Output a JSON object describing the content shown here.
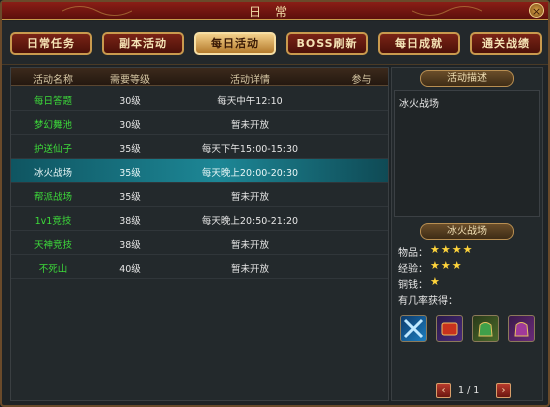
{
  "window": {
    "title": "日常",
    "close_label": "×"
  },
  "tabs": [
    {
      "label": "日常任务",
      "active": false
    },
    {
      "label": "副本活动",
      "active": false
    },
    {
      "label": "每日活动",
      "active": true
    },
    {
      "label": "BOSS刷新",
      "active": false
    },
    {
      "label": "每日成就",
      "active": false
    },
    {
      "label": "通关战绩",
      "active": false
    }
  ],
  "table": {
    "headers": [
      "活动名称",
      "需要等级",
      "活动详情",
      "参与"
    ],
    "rows": [
      {
        "name": "每日答题",
        "level": "30级",
        "detail": "每天中午12:10"
      },
      {
        "name": "梦幻舞池",
        "level": "30级",
        "detail": "暂未开放"
      },
      {
        "name": "护送仙子",
        "level": "35级",
        "detail": "每天下午15:00-15:30"
      },
      {
        "name": "冰火战场",
        "level": "35级",
        "detail": "每天晚上20:00-20:30",
        "selected": true
      },
      {
        "name": "帮派战场",
        "level": "35级",
        "detail": "暂未开放"
      },
      {
        "name": "1v1竞技",
        "level": "38级",
        "detail": "每天晚上20:50-21:20"
      },
      {
        "name": "天神竞技",
        "level": "38级",
        "detail": "暂未开放"
      },
      {
        "name": "不死山",
        "level": "40级",
        "detail": "暂未开放"
      }
    ]
  },
  "side": {
    "desc_header": "活动描述",
    "desc_text": "冰火战场",
    "detail_header": "冰火战场",
    "stats": [
      {
        "label": "物品：",
        "stars": "★★★★",
        "rating": 4
      },
      {
        "label": "经验：",
        "stars": "★★★",
        "rating": 3
      },
      {
        "label": "铜钱：",
        "stars": "★",
        "rating": 1
      }
    ],
    "rewards_label": "有几率获得：",
    "reward_icons": [
      "crossed-blades-icon",
      "red-tome-icon",
      "green-pouch-icon",
      "purple-pouch-icon"
    ],
    "pager": {
      "prev": "‹",
      "text": "1 / 1",
      "next": "›"
    }
  },
  "colors": {
    "accent_green": "#3ddc3a",
    "tab_active": "#f3d08a",
    "selected_row": "#1d8796",
    "star": "#ffd43b"
  }
}
